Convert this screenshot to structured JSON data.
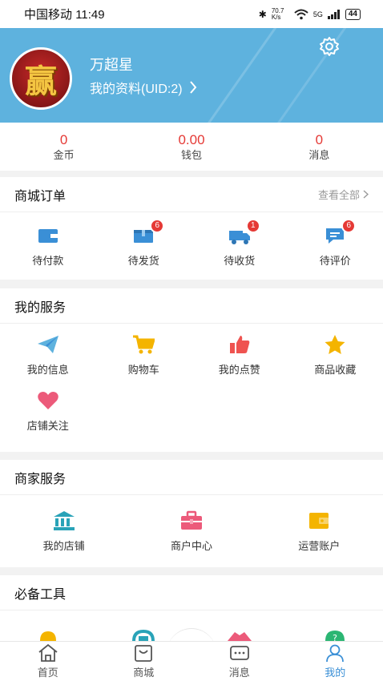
{
  "status_bar": {
    "carrier": "中国移动",
    "time": "11:49",
    "speed": "70.7 K/s",
    "network": "5G",
    "battery": "44"
  },
  "profile": {
    "name": "万超星",
    "link_text": "我的资料(UID:2)",
    "avatar_text": "赢"
  },
  "stats": [
    {
      "value": "0",
      "label": "金币"
    },
    {
      "value": "0.00",
      "label": "钱包"
    },
    {
      "value": "0",
      "label": "消息"
    }
  ],
  "orders": {
    "title": "商城订单",
    "view_all": "查看全部",
    "items": [
      {
        "label": "待付款",
        "icon": "wallet-icon"
      },
      {
        "label": "待发货",
        "icon": "box-icon",
        "badge": "6"
      },
      {
        "label": "待收货",
        "icon": "truck-icon",
        "badge": "1"
      },
      {
        "label": "待评价",
        "icon": "comment-icon",
        "badge": "6"
      }
    ]
  },
  "services": {
    "title": "我的服务",
    "items": [
      {
        "label": "我的信息",
        "icon": "paper-plane-icon"
      },
      {
        "label": "购物车",
        "icon": "cart-icon"
      },
      {
        "label": "我的点赞",
        "icon": "thumbs-up-icon"
      },
      {
        "label": "商品收藏",
        "icon": "star-icon"
      },
      {
        "label": "店铺关注",
        "icon": "heart-icon"
      }
    ]
  },
  "merchant": {
    "title": "商家服务",
    "items": [
      {
        "label": "我的店铺",
        "icon": "bank-icon"
      },
      {
        "label": "商户中心",
        "icon": "briefcase-icon"
      },
      {
        "label": "运营账户",
        "icon": "wallet-icon"
      }
    ]
  },
  "tools": {
    "title": "必备工具"
  },
  "tabs": [
    {
      "label": "首页",
      "icon": "home-icon"
    },
    {
      "label": "商城",
      "icon": "shopping-bag-icon"
    },
    {
      "label": "消息",
      "icon": "message-icon"
    },
    {
      "label": "我的",
      "icon": "user-icon",
      "active": true
    }
  ],
  "colors": {
    "header": "#5eb2de",
    "accent": "#3a8fd6",
    "value_red": "#e53935"
  }
}
